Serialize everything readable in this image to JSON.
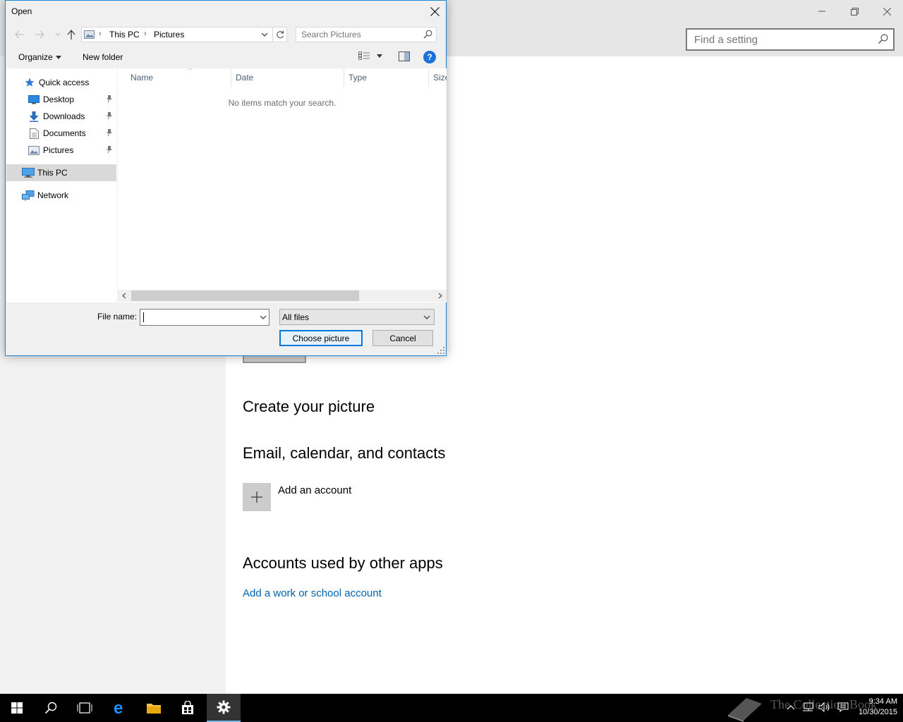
{
  "settings": {
    "search_placeholder": "Find a setting",
    "create_heading": "Create your picture",
    "email_heading": "Email, calendar, and contacts",
    "add_account_label": "Add an account",
    "other_apps_heading": "Accounts used by other apps",
    "work_link": "Add a work or school account"
  },
  "dialog": {
    "title": "Open",
    "breadcrumbs": [
      "This PC",
      "Pictures"
    ],
    "search_placeholder": "Search Pictures",
    "toolbar": {
      "organize": "Organize",
      "new_folder": "New folder",
      "help": "?"
    },
    "nav": {
      "quick_access": "Quick access",
      "desktop": "Desktop",
      "downloads": "Downloads",
      "documents": "Documents",
      "pictures": "Pictures",
      "this_pc": "This PC",
      "network": "Network"
    },
    "columns": {
      "name": "Name",
      "date": "Date",
      "type": "Type",
      "size": "Size"
    },
    "empty_message": "No items match your search.",
    "file_name_label": "File name:",
    "file_name_value": "",
    "filter_selected": "All files",
    "choose_button": "Choose picture",
    "cancel_button": "Cancel"
  },
  "taskbar": {
    "watermark": "The Collection Book",
    "time": "9:34 AM",
    "date": "10/30/2015"
  },
  "colors": {
    "accent": "#0078d7",
    "link": "#0063b1",
    "selection": "#d9d9d9"
  }
}
